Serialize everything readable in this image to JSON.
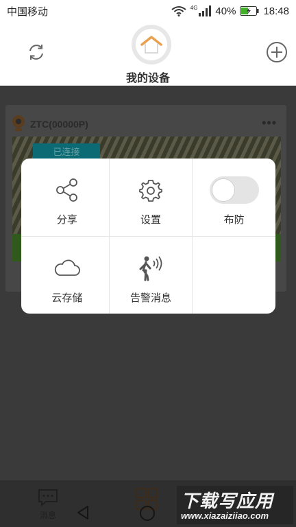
{
  "status_bar": {
    "carrier": "中国移动",
    "network": "4G",
    "battery": "40%",
    "time": "18:48"
  },
  "header": {
    "title": "我的设备"
  },
  "device": {
    "name": "ZTC(00000P)",
    "status": "已连接"
  },
  "popup": {
    "items": [
      {
        "label": "分享",
        "icon": "share-icon"
      },
      {
        "label": "设置",
        "icon": "gear-icon"
      },
      {
        "label": "布防",
        "icon": "toggle-switch",
        "toggle_on": false
      },
      {
        "label": "云存储",
        "icon": "cloud-icon"
      },
      {
        "label": "告警消息",
        "icon": "alarm-walker-icon"
      }
    ]
  },
  "bottom_nav": {
    "message_label": "消息"
  },
  "watermark": {
    "title": "下载写应用",
    "url": "www.xiazaiziiao.com"
  },
  "colors": {
    "accent_orange": "#e8a04f",
    "badge_teal": "#0b6a73",
    "overlay_bg": "#3a3a3a"
  }
}
